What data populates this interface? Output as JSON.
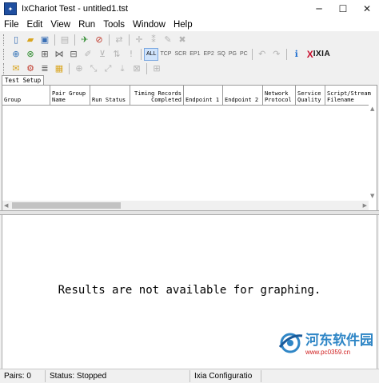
{
  "window": {
    "title": "IxChariot Test - untitled1.tst",
    "minimize": "─",
    "maximize": "☐",
    "close": "✕"
  },
  "menu": [
    "File",
    "Edit",
    "View",
    "Run",
    "Tools",
    "Window",
    "Help"
  ],
  "filter_tabs": [
    "ALL",
    "TCP",
    "SCR",
    "EP1",
    "EP2",
    "SQ",
    "PG",
    "PC"
  ],
  "active_filter": "ALL",
  "brand": {
    "x": "X",
    "name": "IXIA"
  },
  "tab": "Test Setup",
  "grid": {
    "columns": [
      "Group",
      "Pair Group Name",
      "Run Status",
      "Timing Records Completed",
      "Endpoint 1",
      "Endpoint 2",
      "Network Protocol",
      "Service Quality",
      "Script/Stream Filename"
    ],
    "rows": []
  },
  "graph_message": "Results are not available for graphing.",
  "watermark": {
    "name": "河东软件园",
    "url": "www.pc0359.cn"
  },
  "status": {
    "pairs": "Pairs: 0",
    "status": "Status: Stopped",
    "config": "Ixia Configuratio"
  },
  "colors": {
    "accent": "#1f4fa0",
    "ixia_red": "#c8102e",
    "watermark_blue": "#2f86c6"
  },
  "icons": {
    "toolbar1": [
      "new-file-icon",
      "open-folder-icon",
      "save-icon",
      "print-preview-icon",
      "run-icon",
      "stop-icon",
      "swap-icon",
      "add-pair-icon",
      "copy-pair-icon",
      "delete-pair-icon"
    ],
    "toolbar3": [
      "error-log-icon",
      "gear-icon",
      "stack-icon",
      "chart-icon"
    ]
  }
}
